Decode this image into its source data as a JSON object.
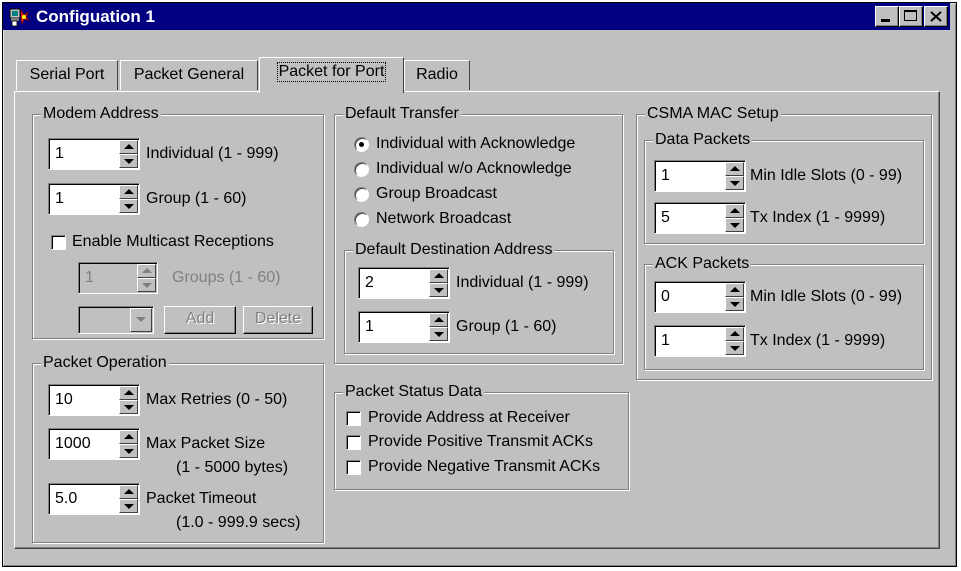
{
  "window": {
    "title": "Configuation 1"
  },
  "tabs": [
    {
      "label": "Serial Port",
      "active": false
    },
    {
      "label": "Packet General",
      "active": false
    },
    {
      "label": "Packet for Port",
      "active": true
    },
    {
      "label": "Radio",
      "active": false
    }
  ],
  "modem_address": {
    "legend": "Modem Address",
    "individual": {
      "value": "1",
      "label": "Individual  (1 - 999)"
    },
    "group": {
      "value": "1",
      "label": "Group  (1 - 60)"
    },
    "enable_multicast_label": "Enable Multicast Receptions",
    "groups": {
      "value": "1",
      "label": "Groups  (1 - 60)"
    },
    "add_label": "Add",
    "delete_label": "Delete"
  },
  "packet_operation": {
    "legend": "Packet Operation",
    "max_retries": {
      "value": "10",
      "label": "Max Retries   (0 - 50)"
    },
    "max_packet_size": {
      "value": "1000",
      "label": "Max Packet Size",
      "range": "(1 - 5000 bytes)"
    },
    "packet_timeout": {
      "value": "5.0",
      "label": "Packet Timeout",
      "range": "(1.0 - 999.9 secs)"
    }
  },
  "default_transfer": {
    "legend": "Default Transfer",
    "options": [
      {
        "label": "Individual with Acknowledge",
        "selected": true
      },
      {
        "label": "Individual w/o Acknowledge",
        "selected": false
      },
      {
        "label": "Group Broadcast",
        "selected": false
      },
      {
        "label": "Network Broadcast",
        "selected": false
      }
    ],
    "destination": {
      "legend": "Default Destination Address",
      "individual": {
        "value": "2",
        "label": "Individual  (1 - 999)"
      },
      "group": {
        "value": "1",
        "label": "Group  (1 - 60)"
      }
    }
  },
  "packet_status": {
    "legend": "Packet Status Data",
    "options": [
      "Provide Address at Receiver",
      "Provide Positive Transmit ACKs",
      "Provide Negative Transmit ACKs"
    ]
  },
  "csma": {
    "legend": "CSMA MAC Setup",
    "data_packets": {
      "legend": "Data Packets",
      "min_idle": {
        "value": "1",
        "label": "Min Idle Slots  (0 - 99)"
      },
      "tx_index": {
        "value": "5",
        "label": "Tx Index  (1 - 9999)"
      }
    },
    "ack_packets": {
      "legend": "ACK Packets",
      "min_idle": {
        "value": "0",
        "label": "Min Idle Slots  (0 - 99)"
      },
      "tx_index": {
        "value": "1",
        "label": "Tx Index  (1 - 9999)"
      }
    }
  }
}
